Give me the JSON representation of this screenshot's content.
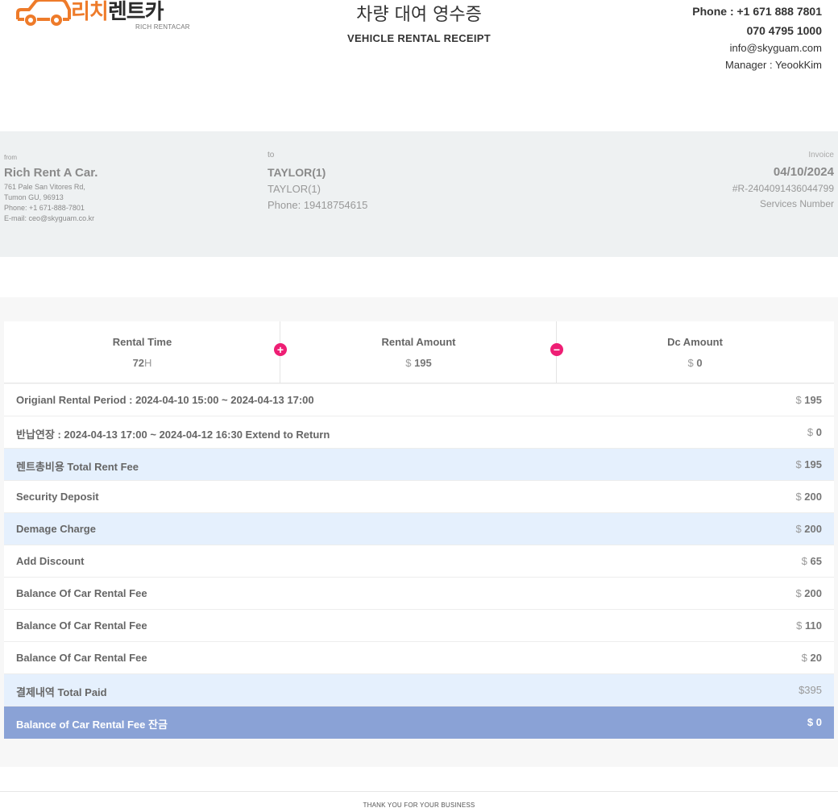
{
  "brand": {
    "logo_kr": "리치렌트카",
    "logo_kr_accent": "리치",
    "logo_kr_rest": "렌트카",
    "logo_en": "RICH RENTACAR",
    "accent_color": "#ee7b2a"
  },
  "title": {
    "kr": "차량 대여 영수증",
    "en": "VEHICLE RENTAL RECEIPT"
  },
  "contact": {
    "phone": "Phone : +1 671 888 7801",
    "phone2": "070 4795 1000",
    "email": "info@skyguam.com",
    "manager": "Manager : YeookKim"
  },
  "from": {
    "label": "from",
    "name": "Rich Rent A Car.",
    "address1": "761 Pale San Vitores Rd,",
    "address2": "Tumon GU, 96913",
    "phone": "Phone: +1 671-888-7801",
    "email": "E-mail: ceo@skyguam.co.kr"
  },
  "to": {
    "label": "to",
    "name": "TAYLOR(1)",
    "name2": "TAYLOR(1)",
    "phone": "Phone: 19418754615"
  },
  "invoice": {
    "label": "Invoice",
    "date": "04/10/2024",
    "number": "#R-2404091436044799",
    "services": "Services Number"
  },
  "summary": {
    "rental_time_label": "Rental Time",
    "rental_time_value": "72",
    "rental_time_unit": "H",
    "plus_icon": "+",
    "rental_amount_label": "Rental Amount",
    "rental_amount_currency": "$",
    "rental_amount_value": "195",
    "minus_icon": "−",
    "dc_amount_label": "Dc Amount",
    "dc_amount_currency": "$",
    "dc_amount_value": "0",
    "icon_color": "#ee1e74"
  },
  "rows": [
    {
      "label": "Origianl Rental Period : 2024-04-10 15:00 ~ 2024-04-13 17:00",
      "currency": "$",
      "amount": "195"
    },
    {
      "label": "반납연장 : 2024-04-13 17:00 ~ 2024-04-12 16:30 Extend to Return",
      "currency": "$",
      "amount": "0"
    },
    {
      "label": "렌트총비용 Total Rent Fee",
      "currency": "$",
      "amount": "195"
    },
    {
      "label": "Security Deposit",
      "currency": "$",
      "amount": "200"
    },
    {
      "label": "Demage Charge",
      "currency": "$",
      "amount": "200"
    },
    {
      "label": "Add Discount",
      "currency": "$",
      "amount": "65"
    },
    {
      "label": "Balance Of Car Rental Fee",
      "currency": "$",
      "amount": "200"
    },
    {
      "label": "Balance Of Car Rental Fee",
      "currency": "$",
      "amount": "110"
    },
    {
      "label": "Balance Of Car Rental Fee",
      "currency": "$",
      "amount": "20"
    },
    {
      "label": "결제내역 Total Paid",
      "currency": "$",
      "amount": "395"
    },
    {
      "label": "Balance of Car Rental Fee 잔금",
      "currency": "$",
      "amount": "0"
    }
  ],
  "colors": {
    "highlight_row": "#e5f0fd",
    "final_row": "#8aa2d6",
    "info_band": "#eef1f2"
  },
  "footer": {
    "text": "THANK YOU FOR YOUR BUSINESS"
  }
}
